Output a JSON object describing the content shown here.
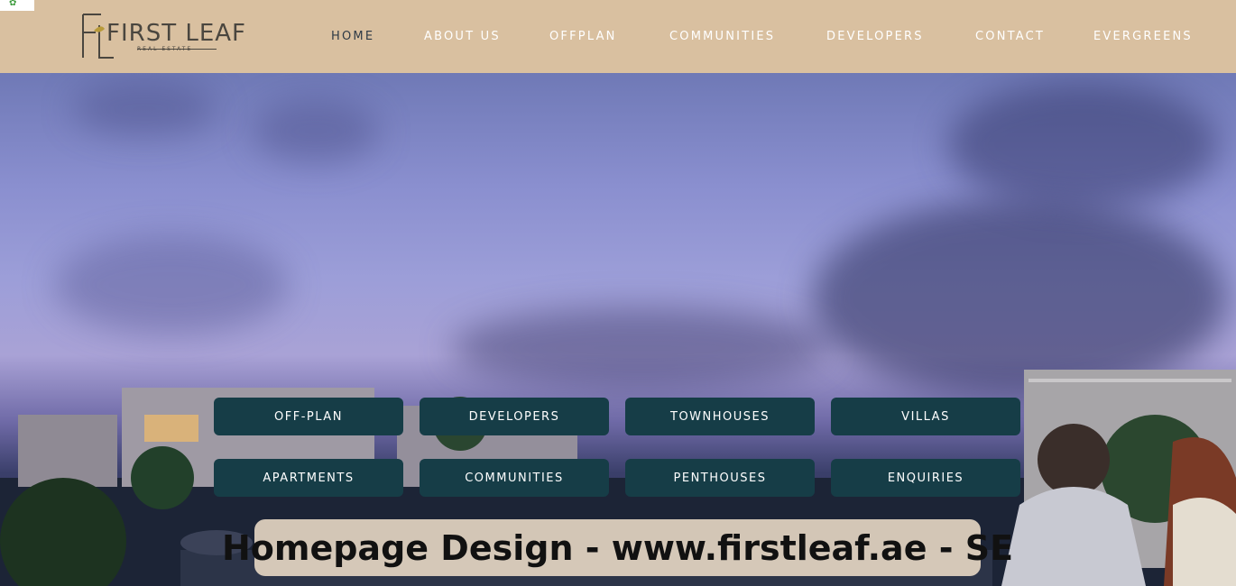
{
  "logo": {
    "wordmark": "FIRST LEAF",
    "subtitle": "REAL ESTATE",
    "monogram": "FL"
  },
  "nav": [
    {
      "label": "HOME",
      "active": true
    },
    {
      "label": "ABOUT US",
      "active": false
    },
    {
      "label": "OFFPLAN",
      "active": false
    },
    {
      "label": "COMMUNITIES",
      "active": false
    },
    {
      "label": "DEVELOPERS",
      "active": false
    },
    {
      "label": "CONTACT",
      "active": false
    },
    {
      "label": "EVERGREENS",
      "active": false
    }
  ],
  "buttons": [
    {
      "label": "OFF-PLAN"
    },
    {
      "label": "DEVELOPERS"
    },
    {
      "label": "TOWNHOUSES"
    },
    {
      "label": "VILLAS"
    },
    {
      "label": "APARTMENTS"
    },
    {
      "label": "COMMUNITIES"
    },
    {
      "label": "PENTHOUSES"
    },
    {
      "label": "ENQUIRIES"
    }
  ],
  "caption": "Homepage Design - www.firstleaf.ae - SE",
  "colors": {
    "header_bg": "#d9c0a0",
    "button_bg": "#163d47",
    "nav_active": "#2e3a46",
    "nav_inactive": "#ffffff"
  }
}
